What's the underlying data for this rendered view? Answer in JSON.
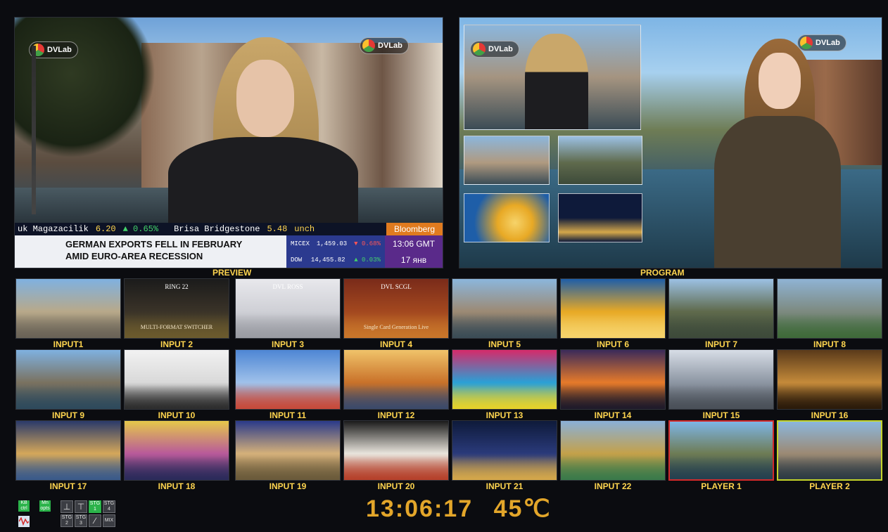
{
  "preview": {
    "label": "PREVIEW",
    "logo_text": "DVLab",
    "ticker": {
      "left_name": "uk Magazacilik",
      "left_value": "6.20",
      "left_change": "▲ 0.65%",
      "right_name": "Brisa Bridgestone",
      "right_value": "5.48",
      "right_status": "unch"
    },
    "bloomberg": "Bloomberg",
    "headline_line1": "GERMAN EXPORTS FELL IN FEBRUARY",
    "headline_line2": "AMID EURO-AREA RECESSION",
    "market": [
      {
        "name": "MICEX",
        "value": "1,459.03",
        "change": "▼ 0.68%"
      },
      {
        "name": "DOW",
        "value": "14,455.82",
        "change": "▲ 0.03%"
      }
    ],
    "time": "13:06 GMT",
    "date": "17 янв"
  },
  "program": {
    "label": "PROGRAM",
    "logo_text": "DVLab",
    "pip_logo_text": "DVLab"
  },
  "inputs": [
    {
      "label": "INPUT1",
      "colors": [
        "#7fb1e0",
        "#b8a98a",
        "#6a6357"
      ]
    },
    {
      "label": "INPUT 2",
      "colors": [
        "#1b1b1b",
        "#3a3328",
        "#6b5a2d"
      ],
      "text1": "RING 22",
      "text2": "MULTI-FORMAT SWITCHER"
    },
    {
      "label": "INPUT 3",
      "colors": [
        "#e8e8ec",
        "#cfd0d6",
        "#9a9ca3"
      ],
      "text1": "DVL ROSS"
    },
    {
      "label": "INPUT 4",
      "colors": [
        "#7a2b1a",
        "#a3481f",
        "#c9762a"
      ],
      "text1": "DVL SCGL",
      "text2": "Single Card Generation Live"
    },
    {
      "label": "INPUT 5",
      "colors": [
        "#8bb6dc",
        "#9c8a74",
        "#3b4c56"
      ]
    },
    {
      "label": "INPUT 6",
      "colors": [
        "#1e5ea8",
        "#e8a925",
        "#f6d36a"
      ]
    },
    {
      "label": "INPUT 7",
      "colors": [
        "#9cc1e4",
        "#5f6a4c",
        "#3d4a3a"
      ]
    },
    {
      "label": "INPUT 8",
      "colors": [
        "#8fb3d4",
        "#7d8a80",
        "#3f6a3a"
      ]
    },
    {
      "label": "INPUT 9",
      "colors": [
        "#7fb1e0",
        "#7a7260",
        "#2e4a5c"
      ]
    },
    {
      "label": "INPUT 10",
      "colors": [
        "#f2f2f2",
        "#d9d9d9",
        "#2c2c2c"
      ]
    },
    {
      "label": "INPUT 11",
      "colors": [
        "#4e86d4",
        "#9fc1ea",
        "#c74a3a"
      ]
    },
    {
      "label": "INPUT 12",
      "colors": [
        "#f0c36a",
        "#c9722a",
        "#3b4a6a"
      ]
    },
    {
      "label": "INPUT 13",
      "colors": [
        "#d62a6a",
        "#2aa0d6",
        "#e6d22a"
      ]
    },
    {
      "label": "INPUT 14",
      "colors": [
        "#3a2a5a",
        "#e67a2a",
        "#1e1a2a"
      ]
    },
    {
      "label": "INPUT 15",
      "colors": [
        "#d7dde6",
        "#8d96a3",
        "#4a5058"
      ]
    },
    {
      "label": "INPUT 16",
      "colors": [
        "#5a3a1a",
        "#c48a3a",
        "#2a1a0a"
      ]
    },
    {
      "label": "INPUT 17",
      "colors": [
        "#2a3a6a",
        "#d4a75a",
        "#3a5a8a"
      ]
    },
    {
      "label": "INPUT 18",
      "colors": [
        "#e6c84a",
        "#b85a9a",
        "#2a2a5a"
      ]
    },
    {
      "label": "INPUT 19",
      "colors": [
        "#2a3a8a",
        "#d4b07a",
        "#6a5a3a"
      ]
    },
    {
      "label": "INPUT 20",
      "colors": [
        "#1a1a1a",
        "#e8e4dc",
        "#b5402a"
      ]
    },
    {
      "label": "INPUT 21",
      "colors": [
        "#0e1a3a",
        "#2a3a7a",
        "#d4a74a"
      ]
    },
    {
      "label": "INPUT 22",
      "colors": [
        "#8ab0d8",
        "#c4a14a",
        "#3a7a4a"
      ]
    },
    {
      "label": "PLAYER 1",
      "colors": [
        "#7eb5e5",
        "#6e7c55",
        "#25404f"
      ]
    },
    {
      "label": "PLAYER 2",
      "colors": [
        "#8bb6dc",
        "#9c8a74",
        "#2e3b44"
      ]
    }
  ],
  "status": {
    "clock": "13:06:17",
    "temperature": "45℃"
  },
  "controls": {
    "kb_label": "KB\nctrl",
    "mn_label": "Mn\nopts",
    "stg1": "STG\n1",
    "stg2": "STG\n2",
    "stg3": "STG\n3",
    "stg4": "STG\n4",
    "mix": "MIX"
  },
  "colors": {
    "label_yellow": "#ffd54f",
    "clock_amber": "#e3a62a",
    "player1_border": "#d42a2a",
    "player2_border": "#c4d42a",
    "bloomberg_orange": "#e07b1f"
  }
}
